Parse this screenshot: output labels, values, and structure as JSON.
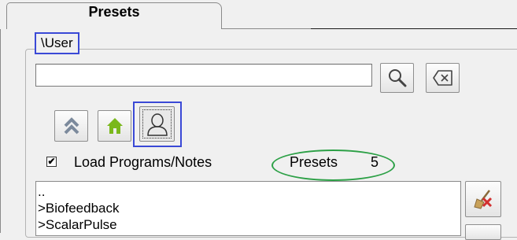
{
  "tab": {
    "label": "Presets"
  },
  "path": {
    "label": "\\User"
  },
  "search": {
    "value": "",
    "placeholder": ""
  },
  "options": {
    "load_programs_notes": {
      "label": "Load Programs/Notes",
      "checked": true,
      "check_glyph": "✔"
    },
    "presets_label": "Presets",
    "presets_count": "5"
  },
  "list": {
    "items": [
      {
        "label": ".."
      },
      {
        "label": ">Biofeedback"
      },
      {
        "label": ">ScalarPulse"
      }
    ]
  },
  "icons": {
    "search": "magnifier-icon",
    "clear": "backspace-clear-icon",
    "up": "double-chevron-up-icon",
    "home": "home-icon",
    "user": "user-silhouette-icon",
    "delete": "broom-delete-icon"
  },
  "colors": {
    "highlight_blue": "#3a49d6",
    "highlight_green": "#2ca046",
    "home_green": "#7ab81c",
    "up_gray": "#7c8a9c",
    "delete_red": "#d23030"
  }
}
